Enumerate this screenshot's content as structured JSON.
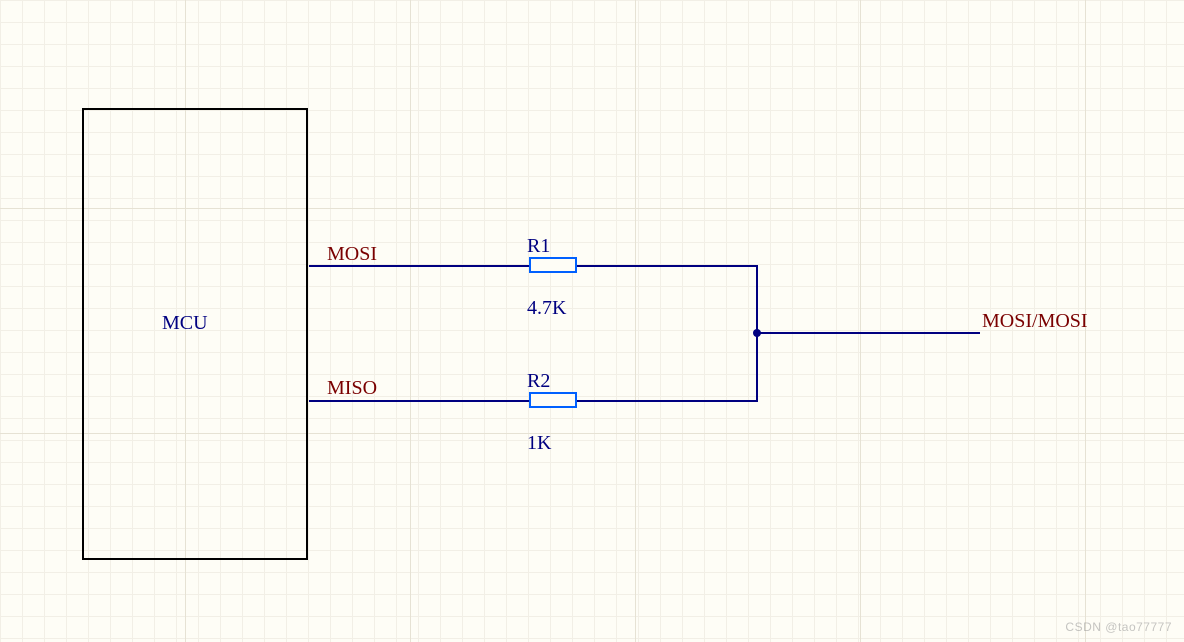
{
  "mcu": {
    "label": "MCU"
  },
  "nets": {
    "mosi": "MOSI",
    "miso": "MISO",
    "right": "MOSI/MOSI"
  },
  "components": {
    "r1": {
      "designator": "R1",
      "value": "4.7K"
    },
    "r2": {
      "designator": "R2",
      "value": "1K"
    }
  },
  "watermark": "CSDN @tao77777"
}
